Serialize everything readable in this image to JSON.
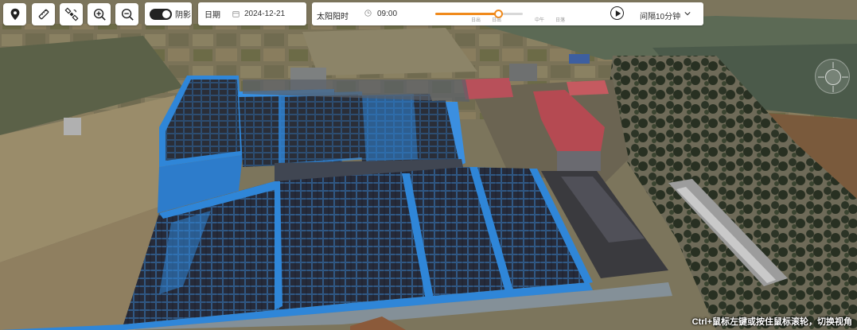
{
  "toolbar": {
    "tools": [
      {
        "name": "location-pin-icon"
      },
      {
        "name": "ruler-icon"
      },
      {
        "name": "satellite-icon"
      },
      {
        "name": "zoom-in-icon"
      },
      {
        "name": "zoom-out-icon"
      }
    ],
    "shadow_toggle": {
      "label": "阴影",
      "on": true
    },
    "date": {
      "label": "日期",
      "value": "2024-12-21",
      "icon": "calendar-icon"
    },
    "sun": {
      "label": "太阳阳时",
      "time_icon": "clock-icon",
      "time_value": "09:00",
      "slider_fraction": 0.72,
      "tick_labels": [
        "日出",
        "日出",
        "中午",
        "日落"
      ],
      "play_icon": "play-icon",
      "interval_value": "间隔10分钟",
      "dropdown_icon": "chevron-down-icon"
    }
  },
  "compass": {
    "icon": "compass-icon"
  },
  "hint": "Ctrl+鼠标左键或按住鼠标滚轮，切换视角",
  "colors": {
    "accent": "#f08a1c",
    "roof_blue": "#2f86d8",
    "panel_dark": "#1c2030"
  }
}
